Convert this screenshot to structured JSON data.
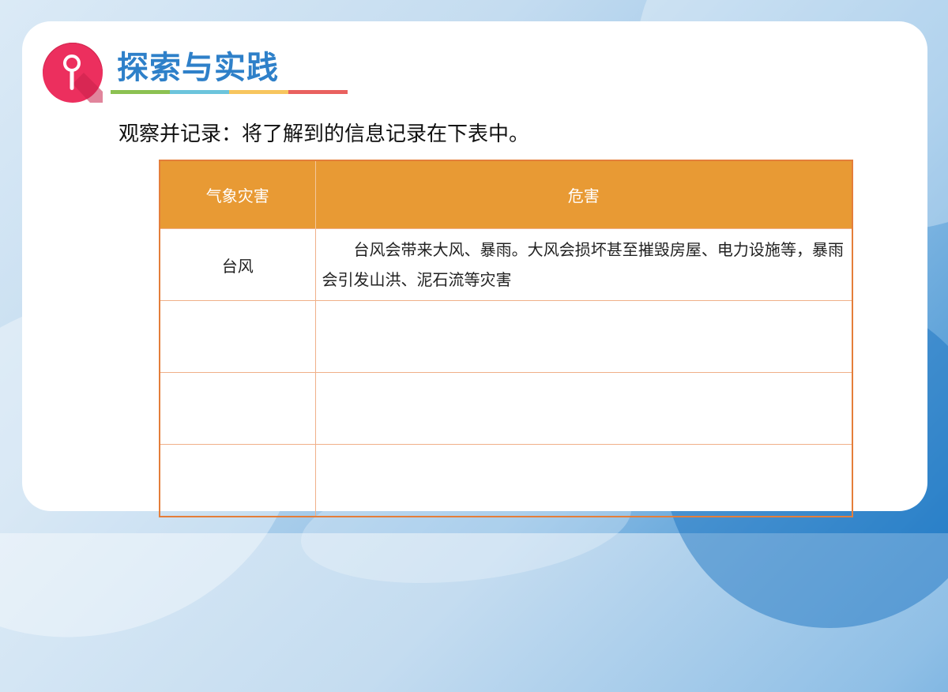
{
  "header": {
    "title": "探索与实践",
    "badge_icon": "magnifier-icon",
    "underline_colors": [
      "#8cc152",
      "#6cc4dc",
      "#f7c55e",
      "#e9615f"
    ]
  },
  "instruction": "观察并记录：将了解到的信息记录在下表中。",
  "table": {
    "columns": [
      "气象灾害",
      "危害"
    ],
    "rows": [
      {
        "disaster": "台风",
        "harm": "台风会带来大风、暴雨。大风会损坏甚至摧毁房屋、电力设施等，暴雨会引发山洪、泥石流等灾害"
      },
      {
        "disaster": "",
        "harm": ""
      },
      {
        "disaster": "",
        "harm": ""
      },
      {
        "disaster": "",
        "harm": ""
      }
    ]
  },
  "colors": {
    "title": "#2e80c9",
    "badge": "#ec2f5e",
    "table_header": "#e89a34",
    "table_border": "#e47e3a"
  }
}
